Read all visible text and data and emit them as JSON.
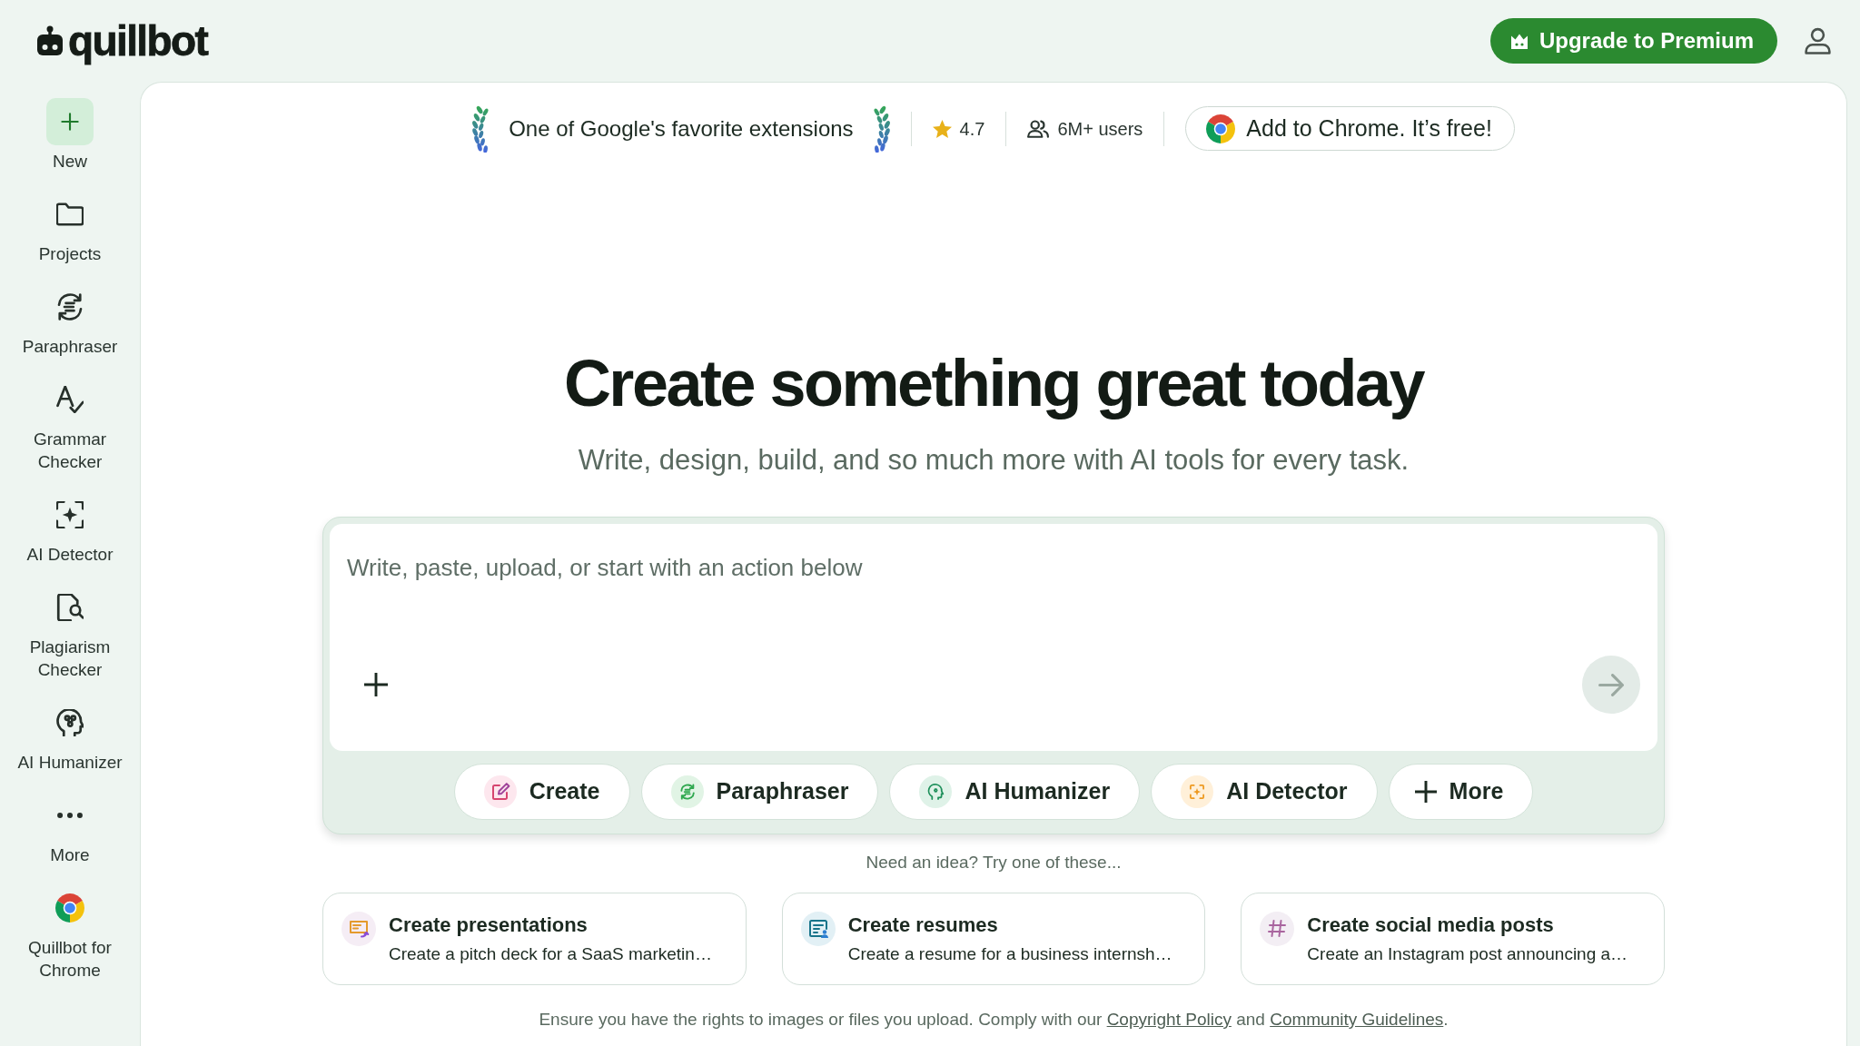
{
  "header": {
    "logo": "quillbot",
    "upgrade_button": "Upgrade to Premium"
  },
  "sidebar": {
    "items": [
      {
        "label": "New",
        "kind": "primary"
      },
      {
        "label": "Projects",
        "kind": "link"
      },
      {
        "label": "Paraphraser",
        "kind": "link"
      },
      {
        "label": "Grammar Checker",
        "kind": "link"
      },
      {
        "label": "AI Detector",
        "kind": "link"
      },
      {
        "label": "Plagiarism Checker",
        "kind": "link"
      },
      {
        "label": "AI Humanizer",
        "kind": "link"
      },
      {
        "label": "More",
        "kind": "link"
      },
      {
        "label": "Quillbot for Chrome",
        "kind": "link"
      }
    ]
  },
  "banner": {
    "badge_text": "One of Google's favorite extensions",
    "rating": "4.7",
    "users": "6M+ users",
    "chrome_button": "Add to Chrome. It’s free!"
  },
  "hero": {
    "title": "Create something great today",
    "subtitle": "Write, design, build, and so much more with AI tools for every task."
  },
  "composer": {
    "placeholder": "Write, paste, upload, or start with an action below",
    "send_button": {
      "disabled": true
    },
    "actions": [
      {
        "label": "Create",
        "kind": "tool"
      },
      {
        "label": "Paraphraser",
        "kind": "tool"
      },
      {
        "label": "AI Humanizer",
        "kind": "tool"
      },
      {
        "label": "AI Detector",
        "kind": "tool"
      },
      {
        "label": "More",
        "kind": "more"
      }
    ]
  },
  "ideas": {
    "heading": "Need an idea? Try one of these...",
    "cards": [
      {
        "title": "Create presentations",
        "description": "Create a pitch deck for a SaaS marketin…"
      },
      {
        "title": "Create resumes",
        "description": "Create a resume for a business internsh…"
      },
      {
        "title": "Create social media posts",
        "description": "Create an Instagram post announcing a…"
      }
    ]
  },
  "footer": {
    "parts": [
      {
        "kind": "text",
        "text": "Ensure you have the rights to images or files you upload. Comply with our "
      },
      {
        "kind": "link",
        "text": "Copyright Policy"
      },
      {
        "kind": "text",
        "text": " and "
      },
      {
        "kind": "link",
        "text": "Community Guidelines"
      },
      {
        "kind": "text",
        "text": "."
      }
    ]
  }
}
